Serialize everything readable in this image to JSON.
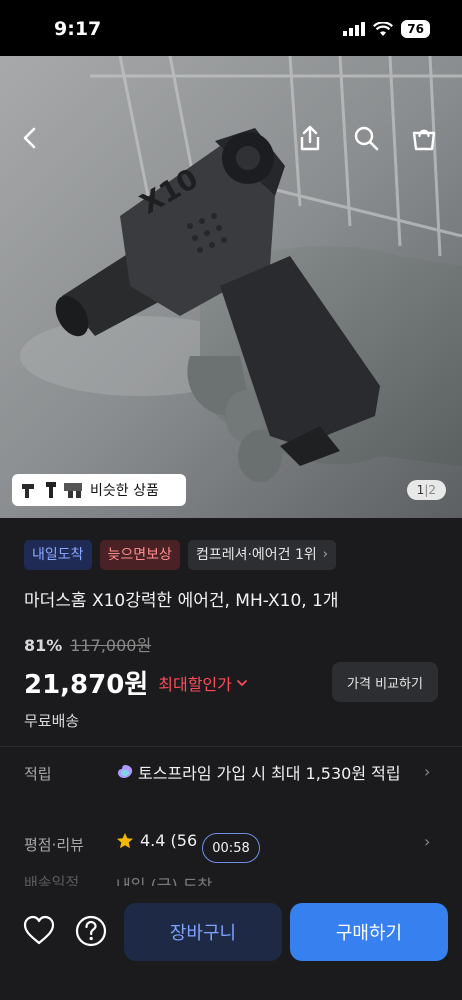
{
  "status": {
    "time": "9:17",
    "battery": "76"
  },
  "hero": {
    "similar_label": "비슷한 상품",
    "page_current": "1",
    "page_separator": "|",
    "page_total": "2",
    "product_mark": "X10"
  },
  "badges": {
    "arrival": "내일도착",
    "compensation": "늦으면보상",
    "rank": "컴프레셔·에어건 1위"
  },
  "product": {
    "title": "마더스홈 X10강력한 에어건, MH-X10, 1개",
    "discount_rate": "81%",
    "original_price": "117,000원",
    "price": "21,870원",
    "max_discount_label": "최대할인가",
    "compare_label": "가격 비교하기",
    "shipping": "무료배송"
  },
  "info": {
    "points_label": "적립",
    "points_text": "토스프라임 가입 시 최대 1,530원 적립",
    "rating_label": "평점·리뷰",
    "rating_value": "4.4 (56",
    "timer": "00:58",
    "delivery_label": "배송일정",
    "delivery_value": "내일 (금) 도착"
  },
  "bottom": {
    "cart_label": "장바구니",
    "buy_label": "구매하기"
  },
  "colors": {
    "accent": "#3680ef",
    "sale_red": "#ff4a5c",
    "background": "#1b1b1d"
  }
}
